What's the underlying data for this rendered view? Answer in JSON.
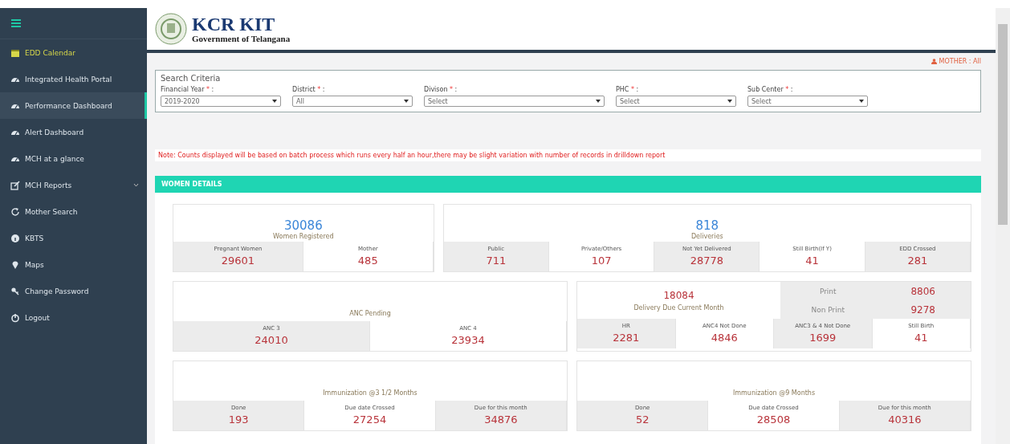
{
  "sidebar": {
    "items": [
      {
        "label": "EDD Calendar",
        "kind": "calendar",
        "highlight": true,
        "selected": false
      },
      {
        "label": "Integrated Health Portal",
        "kind": "dashboard",
        "highlight": false,
        "selected": false
      },
      {
        "label": "Performance Dashboard",
        "kind": "dashboard",
        "highlight": false,
        "selected": true
      },
      {
        "label": "Alert Dashboard",
        "kind": "dashboard",
        "highlight": false,
        "selected": false
      },
      {
        "label": "MCH at a glance",
        "kind": "dashboard",
        "highlight": false,
        "selected": false
      },
      {
        "label": "MCH Reports",
        "kind": "edit",
        "highlight": false,
        "selected": false,
        "expandable": true
      },
      {
        "label": "Mother Search",
        "kind": "refresh",
        "highlight": false,
        "selected": false
      },
      {
        "label": "KBTS",
        "kind": "info",
        "highlight": false,
        "selected": false
      },
      {
        "label": "Maps",
        "kind": "pin",
        "highlight": false,
        "selected": false
      },
      {
        "label": "Change Password",
        "kind": "key",
        "highlight": false,
        "selected": false
      },
      {
        "label": "Logout",
        "kind": "power",
        "highlight": false,
        "selected": false
      }
    ]
  },
  "header": {
    "title": "KCR KIT",
    "subtitle": "Government of Telangana"
  },
  "user_label": "MOTHER : All",
  "search": {
    "title": "Search Criteria",
    "fields": [
      {
        "label": "Financial Year",
        "star": "*",
        "colon": ":",
        "value": "2019-2020"
      },
      {
        "label": "District",
        "star": "*",
        "colon": ":",
        "value": "All"
      },
      {
        "label": "Divison",
        "star": "*",
        "colon": ":",
        "value": "Select"
      },
      {
        "label": "PHC",
        "star": "*",
        "colon": ":",
        "value": "Select"
      },
      {
        "label": "Sub Center",
        "star": "*",
        "colon": ":",
        "value": "Select"
      }
    ]
  },
  "note": "Note: Counts displayed will be based on batch process which runs every half an hour,there may be slight variation with number of records in drilldown report",
  "section_title": "WOMEN DETAILS",
  "rows": [
    [
      {
        "kind": "total",
        "value": "30086",
        "label": "Women Registered",
        "cells": [
          {
            "label": "Pregnant Women",
            "value": "29601"
          },
          {
            "label": "Mother",
            "value": "485"
          }
        ]
      },
      {
        "kind": "total",
        "value": "818",
        "label": "Deliveries",
        "cells": [
          {
            "label": "Public",
            "value": "711"
          },
          {
            "label": "Private/Others",
            "value": "107"
          },
          {
            "label": "Not Yet Delivered",
            "value": "28778"
          },
          {
            "label": "Still Birth(If Y)",
            "value": "41"
          },
          {
            "label": "EDD Crossed",
            "value": "281"
          }
        ]
      }
    ],
    [
      {
        "kind": "plain",
        "label": "ANC Pending",
        "cells": [
          {
            "label": "ANC 3",
            "value": "24010"
          },
          {
            "label": "ANC 4",
            "value": "23934"
          }
        ]
      },
      {
        "kind": "split",
        "value": "18084",
        "label": "Delivery Due Current Month",
        "side": [
          {
            "label": "Print",
            "value": "8806"
          },
          {
            "label": "Non Print",
            "value": "9278"
          }
        ],
        "cells": [
          {
            "label": "HR",
            "value": "2281"
          },
          {
            "label": "ANC4 Not Done",
            "value": "4846"
          },
          {
            "label": "ANC3 & 4 Not Done",
            "value": "1699"
          },
          {
            "label": "Still Birth",
            "value": "41"
          }
        ]
      }
    ],
    [
      {
        "kind": "plain",
        "label": "Immunization @3 1/2 Months",
        "cells": [
          {
            "label": "Done",
            "value": "193"
          },
          {
            "label": "Due date Crossed",
            "value": "27254"
          },
          {
            "label": "Due for this month",
            "value": "34876"
          }
        ]
      },
      {
        "kind": "plain",
        "label": "Immunization @9 Months",
        "cells": [
          {
            "label": "Done",
            "value": "52"
          },
          {
            "label": "Due date Crossed",
            "value": "28508"
          },
          {
            "label": "Due for this month",
            "value": "40316"
          }
        ]
      }
    ]
  ]
}
